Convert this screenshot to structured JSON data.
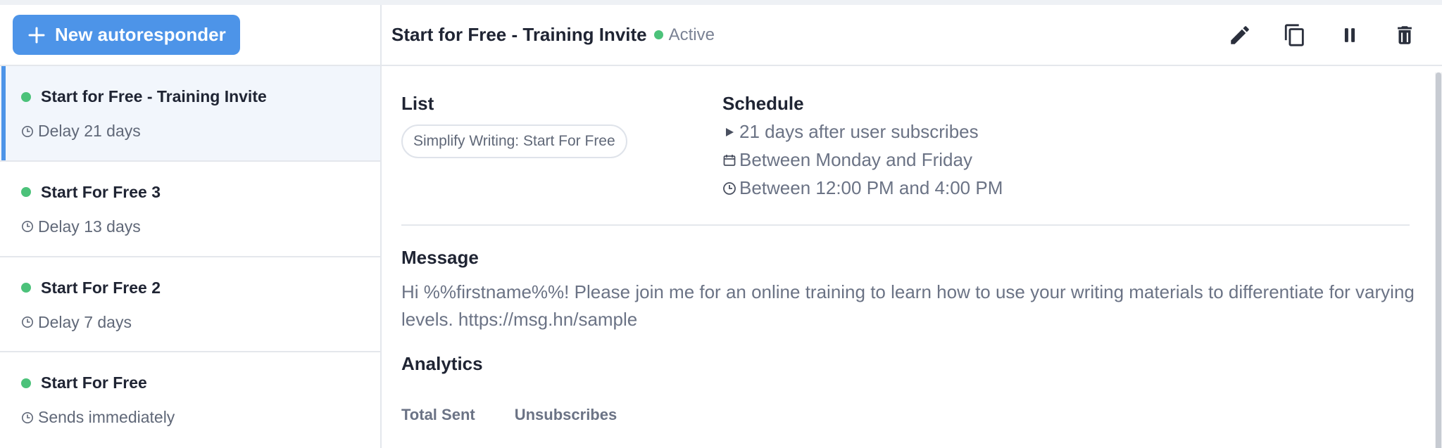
{
  "sidebar": {
    "new_button_label": "New autoresponder",
    "items": [
      {
        "title": "Start for Free - Training Invite",
        "subtitle": "Delay 21 days",
        "status_color": "#4cc27a",
        "active": true
      },
      {
        "title": "Start For Free 3",
        "subtitle": "Delay 13 days",
        "status_color": "#4cc27a",
        "active": false
      },
      {
        "title": "Start For Free 2",
        "subtitle": "Delay 7 days",
        "status_color": "#4cc27a",
        "active": false
      },
      {
        "title": "Start For Free",
        "subtitle": "Sends immediately",
        "status_color": "#4cc27a",
        "active": false
      }
    ]
  },
  "header": {
    "title": "Start for Free - Training Invite",
    "status": "Active",
    "actions": [
      "pencil-icon",
      "copy-icon",
      "pause-icon",
      "trash-icon"
    ]
  },
  "detail": {
    "list_heading": "List",
    "list_value": "Simplify Writing: Start For Free",
    "schedule_heading": "Schedule",
    "schedule_lines": [
      "21 days after user subscribes",
      "Between Monday and Friday",
      "Between 12:00 PM and 4:00 PM"
    ],
    "message_heading": "Message",
    "message_text": "Hi %%firstname%%! Please join me for an online training to learn how to use your writing materials to differentiate for varying levels. https://msg.hn/sample",
    "analytics_heading": "Analytics",
    "analytics_columns": [
      "Total Sent",
      "Unsubscribes"
    ]
  },
  "colors": {
    "accent": "#4d94e8",
    "active_status": "#4cc27a"
  }
}
